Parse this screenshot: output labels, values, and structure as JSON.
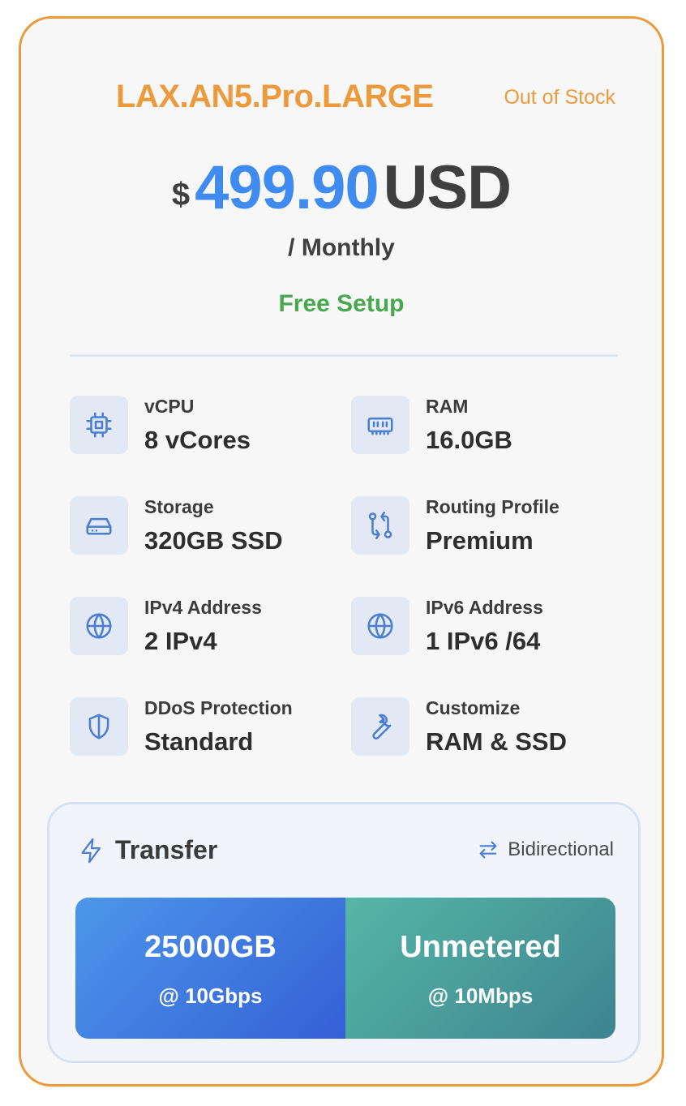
{
  "plan": {
    "name": "LAX.AN5.Pro.LARGE",
    "stock_status": "Out of Stock",
    "currency_symbol": "$",
    "price": "499.90",
    "currency": "USD",
    "period": "/ Monthly",
    "setup": "Free Setup"
  },
  "specs": [
    {
      "label": "vCPU",
      "value": "8 vCores",
      "icon": "cpu-icon"
    },
    {
      "label": "RAM",
      "value": "16.0GB",
      "icon": "memory-icon"
    },
    {
      "label": "Storage",
      "value": "320GB SSD",
      "icon": "hard-drive-icon"
    },
    {
      "label": "Routing Profile",
      "value": "Premium",
      "icon": "route-icon"
    },
    {
      "label": "IPv4 Address",
      "value": "2 IPv4",
      "icon": "globe-icon"
    },
    {
      "label": "IPv6 Address",
      "value": "1 IPv6 /64",
      "icon": "globe-icon"
    },
    {
      "label": "DDoS Protection",
      "value": "Standard",
      "icon": "shield-icon"
    },
    {
      "label": "Customize",
      "value": "RAM & SSD",
      "icon": "wrench-icon"
    }
  ],
  "transfer": {
    "title": "Transfer",
    "mode": "Bidirectional",
    "bars": [
      {
        "amount": "25000GB",
        "speed": "@ 10Gbps"
      },
      {
        "amount": "Unmetered",
        "speed": "@ 10Mbps"
      }
    ]
  },
  "colors": {
    "accent": "#ec9a3c",
    "price": "#3f8bf0",
    "setup": "#48a84f",
    "icon": "#4a7fd0"
  }
}
